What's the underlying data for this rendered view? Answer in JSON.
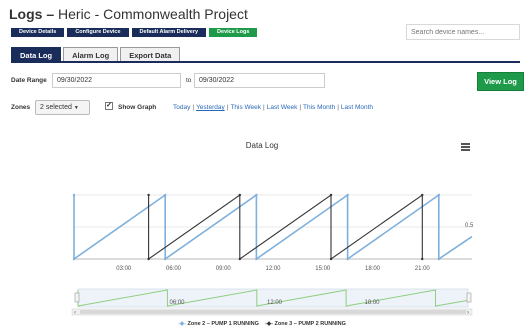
{
  "header": {
    "title_bold": "Logs –",
    "title_rest": "Heric - Commonwealth Project",
    "search_placeholder": "Search device names..."
  },
  "nav_pills": [
    {
      "label": "Device Details"
    },
    {
      "label": "Configure Device"
    },
    {
      "label": "Default Alarm Delivery"
    },
    {
      "label": "Device Logs"
    }
  ],
  "tabs": [
    {
      "label": "Data Log",
      "active": true
    },
    {
      "label": "Alarm Log"
    },
    {
      "label": "Export Data"
    }
  ],
  "filters": {
    "date_range_label": "Date Range",
    "from_date": "09/30/2022",
    "to_label": "to",
    "to_date": "09/30/2022",
    "view_button": "View Log",
    "zones_label": "Zones",
    "zones_value": "2 selected",
    "show_graph_label": "Show Graph",
    "show_graph_checked": true,
    "quick": [
      "Today",
      "Yesterday",
      "This Week",
      "Last Week",
      "This Month",
      "Last Month"
    ]
  },
  "chart": {
    "title": "Data Log",
    "menu_icon": "hamburger-menu-icon",
    "y_tick_right": "0.5",
    "x_ticks": [
      "03:00",
      "06:00",
      "09:00",
      "12:00",
      "15:00",
      "18:00",
      "21:00"
    ],
    "navigator_ticks": [
      "06:00",
      "12:00",
      "18:00"
    ],
    "legend": [
      {
        "name": "Zone 2 – PUMP 1 RUNNING",
        "color": "#7fb0dd"
      },
      {
        "name": "Zone 3 – PUMP 2 RUNNING",
        "color": "#333333"
      }
    ]
  },
  "chart_data": {
    "type": "line",
    "title": "Data Log",
    "x_range": [
      "00:00",
      "24:00"
    ],
    "y_range": [
      0,
      1
    ],
    "grid": true,
    "legend_position": "bottom",
    "series": [
      {
        "name": "Zone 2 – PUMP 1 RUNNING",
        "color": "#7fb0dd",
        "points": [
          [
            0,
            1
          ],
          [
            0,
            0
          ],
          [
            5.5,
            1
          ],
          [
            5.5,
            0
          ],
          [
            11,
            1
          ],
          [
            11,
            0
          ],
          [
            16.5,
            1
          ],
          [
            16.5,
            0
          ],
          [
            22,
            1
          ],
          [
            22,
            0
          ],
          [
            24,
            0.35
          ]
        ]
      },
      {
        "name": "Zone 3 – PUMP 2 RUNNING",
        "color": "#333333",
        "points": [
          [
            4.5,
            1
          ],
          [
            4.5,
            0
          ],
          [
            10,
            1
          ],
          [
            10,
            0
          ],
          [
            15.5,
            1
          ],
          [
            15.5,
            0
          ],
          [
            21,
            1
          ],
          [
            21,
            0
          ]
        ]
      }
    ]
  }
}
